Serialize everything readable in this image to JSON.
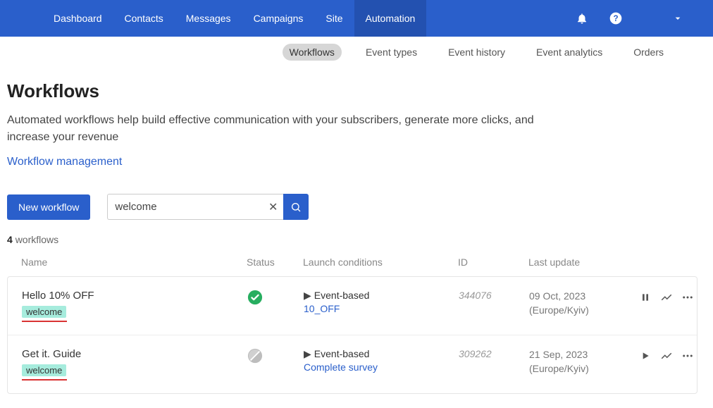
{
  "nav": {
    "items": [
      "Dashboard",
      "Contacts",
      "Messages",
      "Campaigns",
      "Site",
      "Automation"
    ],
    "active_index": 5
  },
  "subnav": {
    "items": [
      "Workflows",
      "Event types",
      "Event history",
      "Event analytics",
      "Orders"
    ],
    "active_index": 0
  },
  "page": {
    "title": "Workflows",
    "description": "Automated workflows help build effective communication with your subscribers, generate more clicks, and increase your revenue",
    "management_link": "Workflow management"
  },
  "controls": {
    "new_workflow": "New workflow"
  },
  "search": {
    "value": "welcome",
    "placeholder": "Search"
  },
  "summary": {
    "count": "4",
    "count_label": "workflows"
  },
  "columns": {
    "name": "Name",
    "status": "Status",
    "launch": "Launch conditions",
    "id": "ID",
    "last_update": "Last update"
  },
  "rows": [
    {
      "name": "Hello 10% OFF",
      "tag": "welcome",
      "status": "active",
      "cond_type": "Event-based",
      "cond_event": "10_OFF",
      "id": "344076",
      "last_update": "09 Oct, 2023 (Europe/Kyiv)",
      "run_icon": "pause"
    },
    {
      "name": "Get it. Guide",
      "tag": "welcome",
      "status": "inactive",
      "cond_type": "Event-based",
      "cond_event": "Complete survey",
      "id": "309262",
      "last_update": "21 Sep, 2023 (Europe/Kyiv)",
      "run_icon": "play"
    }
  ]
}
